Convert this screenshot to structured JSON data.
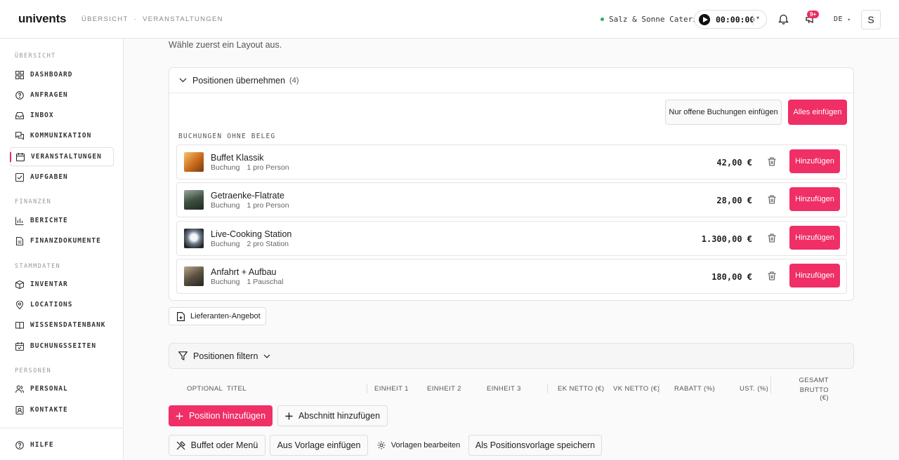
{
  "topbar": {
    "logo": "univents",
    "breadcrumb": [
      "ÜBERSICHT",
      "VERANSTALTUNGEN"
    ],
    "breadcrumb_sep": "·",
    "company": "Salz & Sonne Catering",
    "timer": "00:00:00",
    "notifications_badge": "9+",
    "language": "DE",
    "avatar": "S"
  },
  "sidebar": {
    "sections": {
      "overview": "ÜBERSICHT",
      "finance": "FINANZEN",
      "master": "STAMMDATEN",
      "people": "PERSONEN"
    },
    "items": {
      "dashboard": "DASHBOARD",
      "anfragen": "ANFRAGEN",
      "inbox": "INBOX",
      "kommunikation": "KOMMUNIKATION",
      "veranstaltungen": "VERANSTALTUNGEN",
      "aufgaben": "AUFGABEN",
      "berichte": "BERICHTE",
      "finanzdokumente": "FINANZDOKUMENTE",
      "inventar": "INVENTAR",
      "locations": "LOCATIONS",
      "wissensdatenbank": "WISSENSDATENBANK",
      "buchungsseiten": "BUCHUNGSSEITEN",
      "personal": "PERSONAL",
      "kontakte": "KONTAKTE",
      "hilfe": "HILFE"
    },
    "active": "veranstaltungen"
  },
  "main": {
    "subtitle": "Wähle zuerst ein Layout aus.",
    "positions_card": {
      "title": "Positionen übernehmen",
      "count": "(4)",
      "btn_open": "Nur offene Buchungen einfügen",
      "btn_all": "Alles einfügen",
      "group_label": "BUCHUNGEN OHNE BELEG",
      "rows": [
        {
          "name": "Buffet Klassik",
          "type": "Buchung",
          "qty": "1 pro Person",
          "price": "42,00 €",
          "add": "Hinzufügen"
        },
        {
          "name": "Getraenke-Flatrate",
          "type": "Buchung",
          "qty": "1 pro Person",
          "price": "28,00 €",
          "add": "Hinzufügen"
        },
        {
          "name": "Live-Cooking Station",
          "type": "Buchung",
          "qty": "2 pro Station",
          "price": "1.300,00 €",
          "add": "Hinzufügen"
        },
        {
          "name": "Anfahrt + Aufbau",
          "type": "Buchung",
          "qty": "1 Pauschal",
          "price": "180,00 €",
          "add": "Hinzufügen"
        }
      ]
    },
    "supplier_button": "Lieferanten-Angebot",
    "filter_label": "Positionen filtern",
    "table_headers": {
      "optional": "OPTIONAL",
      "titel": "TITEL",
      "einheit1": "EINHEIT 1",
      "einheit2": "EINHEIT 2",
      "einheit3": "EINHEIT 3",
      "ek_netto": "EK NETTO (€)",
      "vk_netto": "VK NETTO (€)",
      "rabatt": "RABATT (%)",
      "ust": "UST. (%)",
      "gesamt_line1": "GESAMT",
      "gesamt_line2": "BRUTTO (€)"
    },
    "actions": {
      "add_position": "Position hinzufügen",
      "add_section": "Abschnitt hinzufügen",
      "buffet_menu": "Buffet oder Menü",
      "from_template": "Aus Vorlage einfügen",
      "edit_templates": "Vorlagen bearbeiten",
      "save_template": "Als Positionsvorlage speichern"
    }
  },
  "colors": {
    "accent": "#ef2f66",
    "status_online": "#22b55c"
  }
}
